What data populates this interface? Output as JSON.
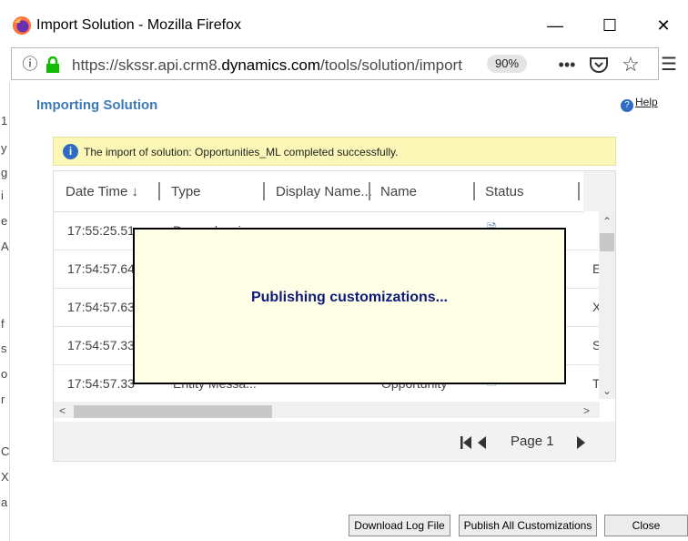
{
  "window": {
    "title": "Import Solution - Mozilla Firefox",
    "minimize": "—",
    "maximize": "☐",
    "close": "✕"
  },
  "urlbar": {
    "url_prefix": "https://skssr.api.crm8.",
    "url_domain": "dynamics.com",
    "url_path": "/tools/solution/import",
    "zoom": "90%"
  },
  "page": {
    "heading": "Importing Solution",
    "help": "Help",
    "notice": "The import of solution: Opportunities_ML completed successfully."
  },
  "grid": {
    "columns": [
      "Date Time ↓",
      "Type",
      "Display Name...",
      "Name",
      "Status"
    ],
    "rows": [
      {
        "time": "17:55:25.51",
        "type": "Dependencies",
        "right": ""
      },
      {
        "time": "17:54:57.64",
        "type": "",
        "right": "E"
      },
      {
        "time": "17:54:57.63",
        "type": "",
        "right": "X"
      },
      {
        "time": "17:54:57.33",
        "type": "",
        "right": "S"
      },
      {
        "time": "17:54:57.33",
        "type": "Entity Messa...",
        "name": "Opportunity",
        "right": "T"
      }
    ],
    "page_label": "Page 1"
  },
  "overlay": {
    "message": "Publishing customizations..."
  },
  "footer": {
    "download": "Download Log File",
    "publish": "Publish All Customizations",
    "close": "Close"
  },
  "left_strip_chars": [
    "1",
    "y",
    "g",
    "i",
    "e",
    "A",
    "f",
    "s",
    "o",
    "r",
    "C",
    "X",
    "a"
  ]
}
